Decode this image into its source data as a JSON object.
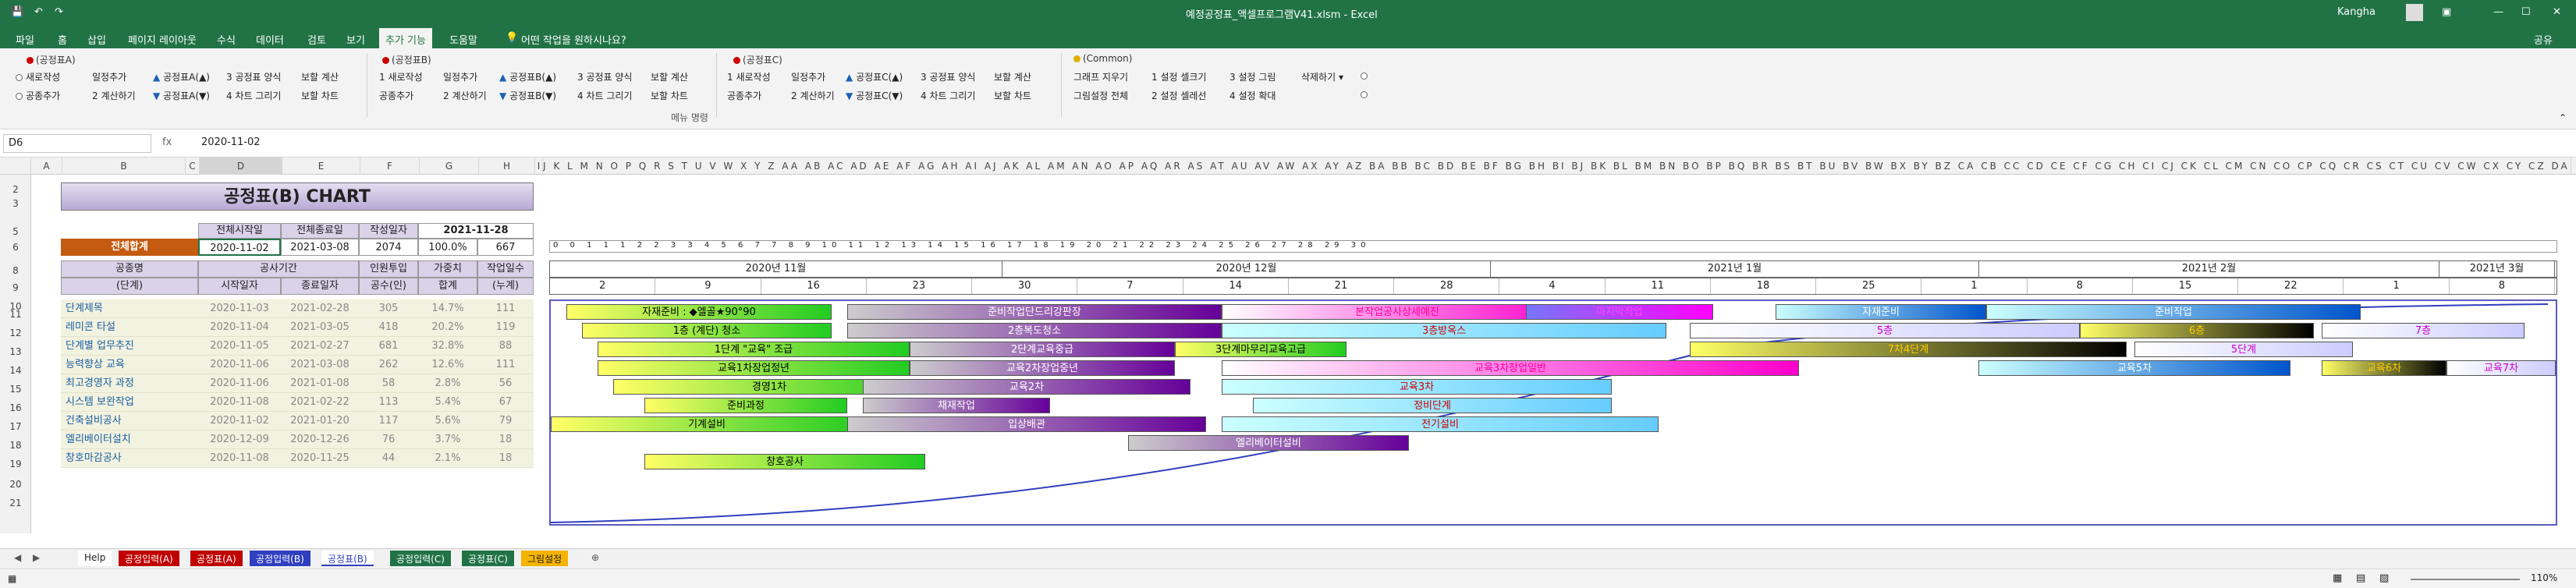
{
  "window": {
    "title": "예정공정표_액셀프로그램V41.xlsm  -  Excel",
    "user": "Kangha",
    "share": "공유"
  },
  "menu": {
    "tabs": [
      "파일",
      "홈",
      "삽입",
      "페이지 레이아웃",
      "수식",
      "데이터",
      "검토",
      "보기",
      "추가 기능",
      "도움말"
    ],
    "active": "추가 기능",
    "tell_me": "어떤 작업을 원하시나요?"
  },
  "ribbon": {
    "group_a": "(공정표A)",
    "group_b": "(공정표B)",
    "group_c": "(공정표C)",
    "group_common": "(Common)",
    "a_items": [
      "새로작성",
      "일정추가",
      "공정표A(▲)",
      "3 공정표 양식",
      "보할 계산",
      "공종추가",
      "2 계산하기",
      "공정표A(▼)",
      "4 차트 그리기",
      "보할 차트"
    ],
    "b_items": [
      "1 새로작성",
      "일정추가",
      "공정표B(▲)",
      "3 공정표 양식",
      "보할 계산",
      "공종추가",
      "2 계산하기",
      "공정표B(▼)",
      "4 차트 그리기",
      "보할 차트"
    ],
    "c_items": [
      "1 새로작성",
      "일정추가",
      "공정표C(▲)",
      "3 공정표 양식",
      "보할 계산",
      "공종추가",
      "2 계산하기",
      "공정표C(▼)",
      "4 차트 그리기",
      "보할 차트"
    ],
    "common_items": [
      "그래프 지우기",
      "1 설정 셀크기",
      "3 설정 그림",
      "삭제하기",
      "그림설정 전체",
      "2 설정 셀레선",
      "4 설정 확대"
    ],
    "footer_label": "메뉴 명령"
  },
  "formula_bar": {
    "name_box": "D6",
    "fx": "fx",
    "value": "2020-11-02"
  },
  "columns": [
    "A",
    "B",
    "C",
    "D",
    "E",
    "F",
    "G",
    "H",
    "I",
    "J",
    "K",
    "L",
    "M",
    "N",
    "O",
    "P",
    "Q",
    "R",
    "S",
    "T",
    "U",
    "V",
    "W",
    "X",
    "Y",
    "Z",
    "AA",
    "AB",
    "AC",
    "AD",
    "AE",
    "AF",
    "AG",
    "AH",
    "AI",
    "AJ",
    "AK",
    "AL",
    "AM",
    "AN",
    "AO",
    "AP",
    "AQ",
    "AR",
    "AS",
    "AT",
    "AU",
    "AV",
    "AW",
    "AX",
    "AY",
    "AZ"
  ],
  "rows": [
    "2",
    "3",
    "5",
    "6",
    "8",
    "9",
    "10",
    "11",
    "12",
    "13",
    "14",
    "15",
    "16",
    "17",
    "18",
    "19",
    "20",
    "21"
  ],
  "sheet": {
    "title": "공정표(B) CHART",
    "summary_headers": [
      "전체시작일",
      "전체종료일",
      "작성일자"
    ],
    "summary_values": [
      "2020-11-02",
      "2021-03-08",
      "2021-11-28"
    ],
    "total_label": "전체합계",
    "total_values": [
      "2074",
      "100.0%",
      "667"
    ],
    "col_headers": {
      "name": "공종명",
      "name_sub": "(단계)",
      "period": "공사기간",
      "start": "시작일자",
      "end": "종료일자",
      "man": "인원투입",
      "man_sub": "공수(인)",
      "weight": "가중치",
      "weight_sub": "합계",
      "workdays": "작업일수",
      "workdays_sub": "(누계)"
    },
    "months": [
      "2020년 11월",
      "2020년 12월",
      "2021년 1월",
      "2021년 2월",
      "2021년 3월"
    ],
    "days": [
      "2",
      "9",
      "16",
      "23",
      "30",
      "7",
      "14",
      "21",
      "28",
      "4",
      "11",
      "18",
      "25",
      "1",
      "8",
      "15",
      "22",
      "1",
      "8"
    ],
    "rows": [
      {
        "name": "단계제목",
        "start": "2020-11-03",
        "end": "2021-02-28",
        "man": "305",
        "weight": "14.7%",
        "days": "111"
      },
      {
        "name": "레미콘 타설",
        "start": "2020-11-04",
        "end": "2021-03-05",
        "man": "418",
        "weight": "20.2%",
        "days": "119"
      },
      {
        "name": "단계별 업무추진",
        "start": "2020-11-05",
        "end": "2021-02-27",
        "man": "681",
        "weight": "32.8%",
        "days": "88"
      },
      {
        "name": "능력향상 교육",
        "start": "2020-11-06",
        "end": "2021-03-08",
        "man": "262",
        "weight": "12.6%",
        "days": "111"
      },
      {
        "name": "최고경영자 과정",
        "start": "2020-11-06",
        "end": "2021-01-08",
        "man": "58",
        "weight": "2.8%",
        "days": "56"
      },
      {
        "name": "시스템 보완작업",
        "start": "2020-11-08",
        "end": "2021-02-22",
        "man": "113",
        "weight": "5.4%",
        "days": "67"
      },
      {
        "name": "건축설비공사",
        "start": "2020-11-02",
        "end": "2021-01-20",
        "man": "117",
        "weight": "5.6%",
        "days": "79"
      },
      {
        "name": "엘리베이터설치",
        "start": "2020-12-09",
        "end": "2020-12-26",
        "man": "76",
        "weight": "3.7%",
        "days": "18"
      },
      {
        "name": "창호마감공사",
        "start": "2020-11-08",
        "end": "2020-11-25",
        "man": "44",
        "weight": "2.1%",
        "days": "18"
      }
    ],
    "bars": [
      [
        "자재준비 : ◆엘골★90°90",
        "준비작업단드리강판장",
        "본작업공사상세예진",
        "마지막작업",
        "자재준비",
        "준비작업"
      ],
      [
        "1층 (계단) 청소",
        "2층복도청소",
        "3층방옥스",
        "5층",
        "6층",
        "7층"
      ],
      [
        "1단계 \"교육\" 조급",
        "2단계교육중급",
        "3단계마무리교육고급",
        "7차4단계",
        "5단계"
      ],
      [
        "교육1차장업정년",
        "교육2차장업중년",
        "교육3차장업일반",
        "교육5차",
        "교육6차",
        "교육7차"
      ],
      [
        "경영1차",
        "교육2차",
        "교육3차"
      ],
      [
        "준비과정",
        "채재작업",
        "정비단계"
      ],
      [
        "기계설비",
        "입상배관",
        "전기설비"
      ],
      [
        "엘리베이터설비"
      ],
      [
        "창호공사"
      ]
    ]
  },
  "sheet_tabs": [
    "Help",
    "공정입력(A)",
    "공정표(A)",
    "공정입력(B)",
    "공정표(B)",
    "공정입력(C)",
    "공정표(C)",
    "그림설정"
  ],
  "active_sheet": "공정표(B)",
  "status": {
    "zoom": "110%"
  },
  "colors": {
    "excel_green": "#217346",
    "header_purple": "#d9d2e9",
    "total_orange": "#c55a11"
  }
}
